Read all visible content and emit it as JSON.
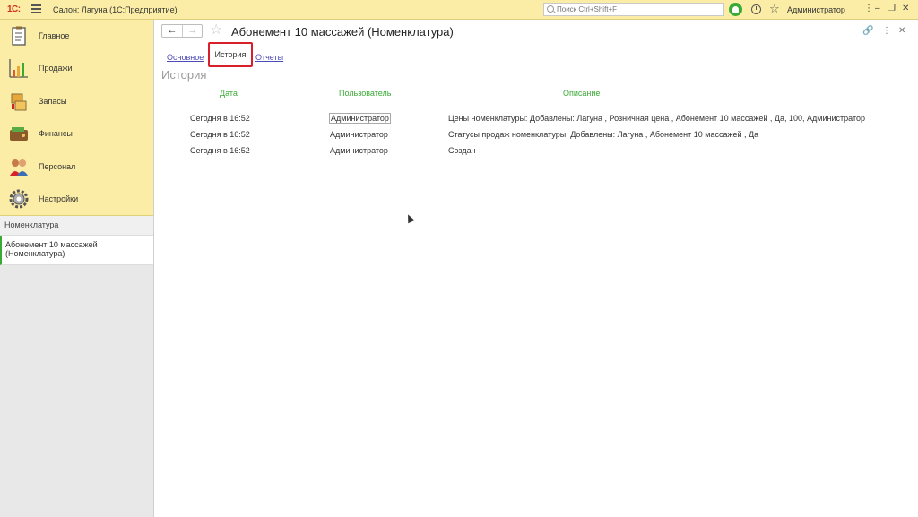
{
  "topbar": {
    "logo": "1С:",
    "title": "Салон: Лагуна  (1С:Предприятие)",
    "search_placeholder": "Поиск Ctrl+Shift+F",
    "user": "Администратор",
    "window_controls": [
      "⋮",
      "–",
      "❐",
      "✕"
    ]
  },
  "sidebar": {
    "sections": [
      {
        "label": "Главное",
        "icon": "main-icon"
      },
      {
        "label": "Продажи",
        "icon": "sales-icon"
      },
      {
        "label": "Запасы",
        "icon": "stock-icon"
      },
      {
        "label": "Финансы",
        "icon": "finance-icon"
      },
      {
        "label": "Персонал",
        "icon": "staff-icon"
      },
      {
        "label": "Настройки",
        "icon": "settings-icon"
      }
    ],
    "open_windows_header": "Номенклатура",
    "open_windows": [
      "Абонемент 10 массажей (Номенклатура)"
    ]
  },
  "content": {
    "title": "Абонемент 10 массажей (Номенклатура)",
    "tabs": [
      {
        "label": "Основное",
        "active": false
      },
      {
        "label": "История",
        "active": true
      },
      {
        "label": "Отчеты",
        "active": false
      }
    ],
    "section_title": "История",
    "table": {
      "columns": [
        "Дата",
        "Пользователь",
        "Описание"
      ],
      "rows": [
        {
          "date": "Сегодня в 16:52",
          "user": "Администратор",
          "desc": "Цены номенклатуры: Добавлены: Лагуна , Розничная цена , Абонемент 10 массажей , Да, 100, Администратор"
        },
        {
          "date": "Сегодня в 16:52",
          "user": "Администратор",
          "desc": "Статусы продаж номенклатуры: Добавлены: Лагуна , Абонемент 10 массажей , Да"
        },
        {
          "date": "Сегодня в 16:52",
          "user": "Администратор",
          "desc": "Создан"
        }
      ]
    }
  },
  "colors": {
    "panel": "#fbeda5",
    "accent_green": "#3aaa35",
    "link": "#4b4bb5",
    "highlight_red": "#d9202a"
  }
}
